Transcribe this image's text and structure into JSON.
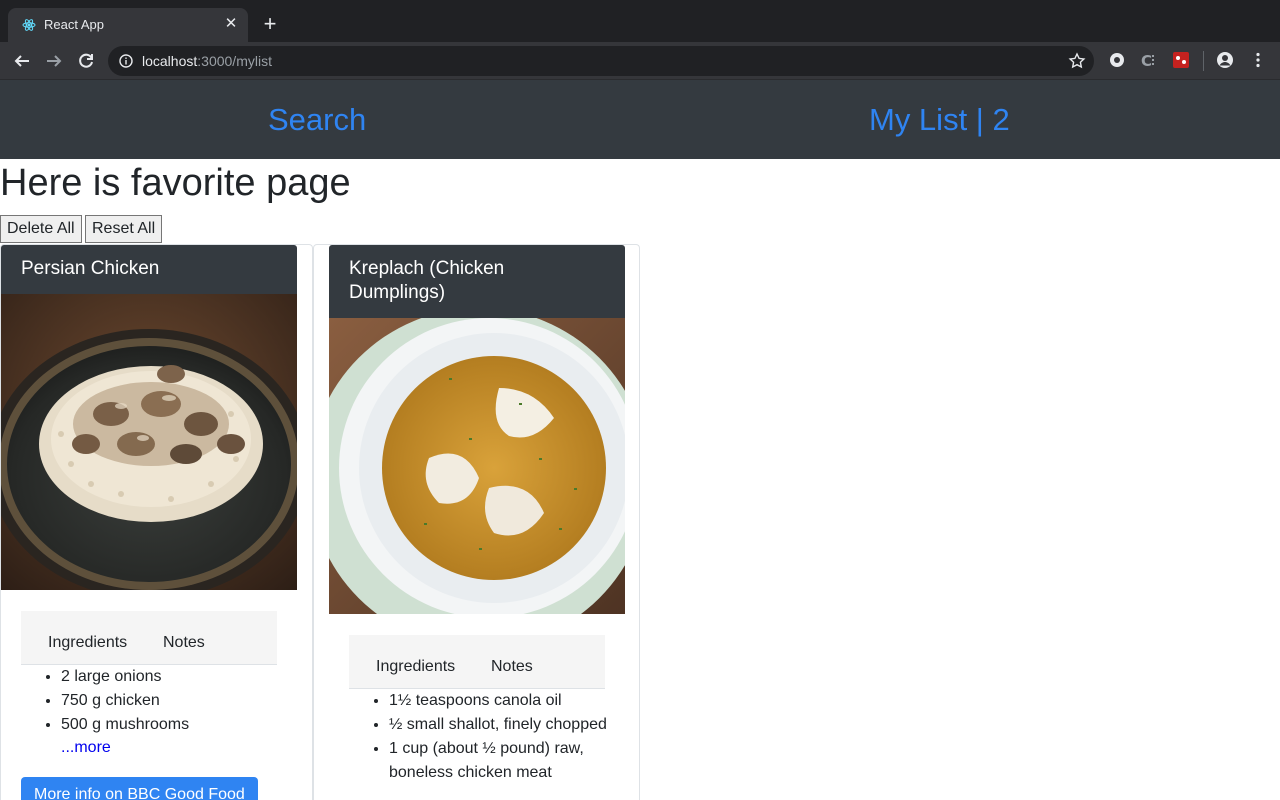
{
  "browser": {
    "tab_title": "React App",
    "url_host": "localhost",
    "url_path": ":3000/mylist"
  },
  "nav": {
    "search_label": "Search",
    "mylist_label": "My List | 2"
  },
  "page": {
    "title": "Here is favorite page",
    "delete_all_label": "Delete All",
    "reset_all_label": "Reset All"
  },
  "cards": [
    {
      "title": "Persian Chicken",
      "tabs": [
        "Ingredients",
        "Notes"
      ],
      "ingredients": [
        "2 large onions",
        "750 g chicken",
        "500 g mushrooms"
      ],
      "more_label": "...more",
      "button_label": "More info on BBC Good Food"
    },
    {
      "title": "Kreplach (Chicken Dumplings)",
      "tabs": [
        "Ingredients",
        "Notes"
      ],
      "ingredients": [
        "1½ teaspoons canola oil",
        "½ small shallot, finely chopped",
        "1 cup (about ½ pound) raw, boneless chicken meat"
      ]
    }
  ],
  "colors": {
    "nav_bg": "#343a40",
    "link_blue": "#2f84f2",
    "card_header_bg": "#343a40"
  }
}
